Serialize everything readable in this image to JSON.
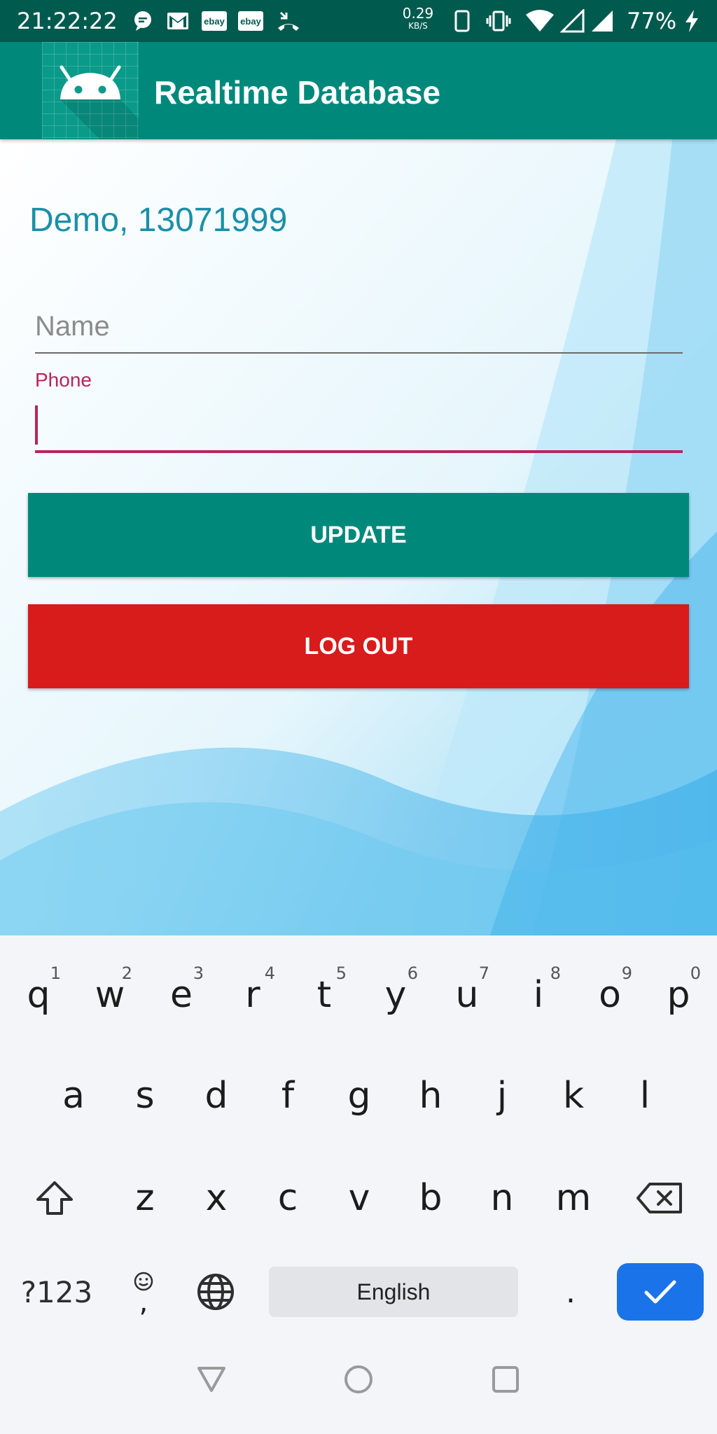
{
  "status_bar": {
    "time": "21:22:22",
    "ebay_1": "ebay",
    "ebay_2": "ebay",
    "net_speed": "0.29",
    "net_unit": "KB/S",
    "battery": "77%",
    "icons": [
      "chat-icon",
      "gmail-icon",
      "ebay-icon",
      "ebay-icon",
      "missed-call-icon",
      "phone-vibrate-icon",
      "wifi-icon",
      "signal-icon",
      "charging-icon"
    ]
  },
  "app_bar": {
    "title": "Realtime Database",
    "icon": "android-icon"
  },
  "main": {
    "greeting": "Demo, 13071999",
    "name_placeholder": "Name",
    "phone_label": "Phone",
    "phone_value": "",
    "update_label": "UPDATE",
    "logout_label": "LOG OUT"
  },
  "keyboard": {
    "row1": [
      {
        "key": "q",
        "hint": "1"
      },
      {
        "key": "w",
        "hint": "2"
      },
      {
        "key": "e",
        "hint": "3"
      },
      {
        "key": "r",
        "hint": "4"
      },
      {
        "key": "t",
        "hint": "5"
      },
      {
        "key": "y",
        "hint": "6"
      },
      {
        "key": "u",
        "hint": "7"
      },
      {
        "key": "i",
        "hint": "8"
      },
      {
        "key": "o",
        "hint": "9"
      },
      {
        "key": "p",
        "hint": "0"
      }
    ],
    "row2": [
      "a",
      "s",
      "d",
      "f",
      "g",
      "h",
      "j",
      "k",
      "l"
    ],
    "row3": [
      "z",
      "x",
      "c",
      "v",
      "b",
      "n",
      "m"
    ],
    "symbols_label": "?123",
    "comma_label": ",",
    "space_label": "English",
    "period_label": "."
  },
  "colors": {
    "accent": "#00897b",
    "status_bar": "#005a4e",
    "logout": "#d81b1b",
    "field_focus": "#b8245c",
    "enter_key": "#1a73e8"
  }
}
